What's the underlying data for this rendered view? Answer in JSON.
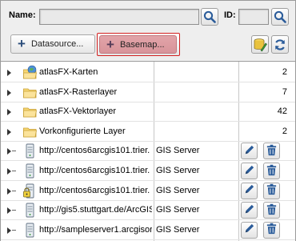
{
  "search": {
    "name_label": "Name:",
    "name_value": "",
    "id_label": "ID:",
    "id_value": ""
  },
  "toolbar": {
    "datasource_label": "Datasource...",
    "basemap_label": "Basemap..."
  },
  "colors": {
    "accent": "#2b5c9a",
    "basemap_bg": "#dba0a5",
    "highlight_border": "#d32020"
  },
  "rows": [
    {
      "name": "atlasFX-Karten",
      "type": "",
      "count": "2",
      "icon": "globe-folder-icon",
      "expandable": true
    },
    {
      "name": "atlasFX-Rasterlayer",
      "type": "",
      "count": "7",
      "icon": "folder-icon",
      "expandable": true
    },
    {
      "name": "atlasFX-Vektorlayer",
      "type": "",
      "count": "42",
      "icon": "folder-icon",
      "expandable": true
    },
    {
      "name": "Vorkonfigurierte Layer",
      "type": "",
      "count": "2",
      "icon": "folder-icon",
      "expandable": true
    },
    {
      "name": "http://centos6arcgis101.trier.",
      "type": "GIS Server",
      "count": "",
      "icon": "server-icon",
      "expandable": false
    },
    {
      "name": "http://centos6arcgis101.trier.",
      "type": "GIS Server",
      "count": "",
      "icon": "server-icon",
      "expandable": false
    },
    {
      "name": "http://centos6arcgis101.trier.",
      "type": "GIS Server",
      "count": "",
      "icon": "locked-server-icon",
      "expandable": false
    },
    {
      "name": "http://gis5.stuttgart.de/ArcGIS",
      "type": "GIS Server",
      "count": "",
      "icon": "server-icon",
      "expandable": false
    },
    {
      "name": "http://sampleserver1.arcgisor",
      "type": "GIS Server",
      "count": "",
      "icon": "server-icon",
      "expandable": false
    }
  ]
}
